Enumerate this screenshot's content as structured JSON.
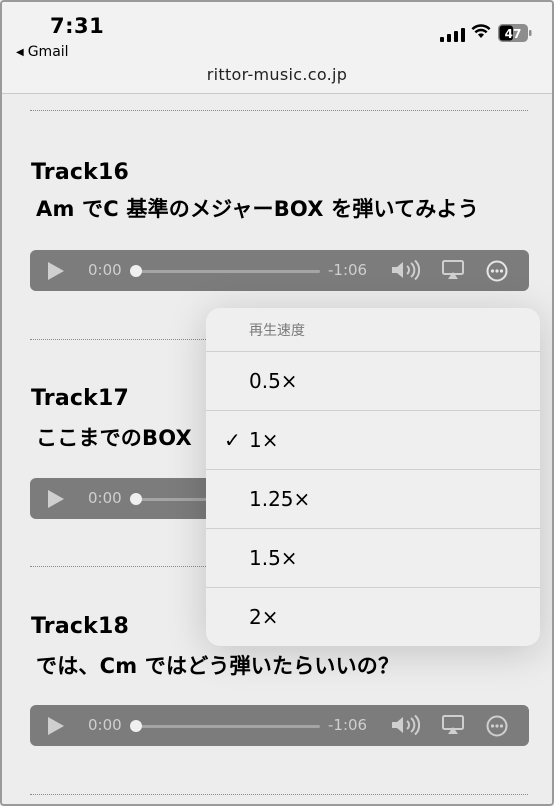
{
  "status_bar": {
    "time": "7:31",
    "back_app": "Gmail",
    "battery_level": "47"
  },
  "url_bar": {
    "domain": "rittor-music.co.jp"
  },
  "tracks": [
    {
      "title": "Track16",
      "subtitle": "Am でC 基準のメジャーBOX を弾いてみよう",
      "player": {
        "current": "0:00",
        "remaining": "-1:06"
      }
    },
    {
      "title": "Track17",
      "subtitle": "ここまでのBOX",
      "player": {
        "current": "0:00",
        "remaining": ""
      }
    },
    {
      "title": "Track18",
      "subtitle": "では、Cm ではどう弾いたらいいの？",
      "player": {
        "current": "0:00",
        "remaining": "-1:06"
      }
    }
  ],
  "speed_menu": {
    "header": "再生速度",
    "options": [
      {
        "label": "0.5×",
        "selected": false
      },
      {
        "label": "1×",
        "selected": true,
        "check": "✓"
      },
      {
        "label": "1.25×",
        "selected": false
      },
      {
        "label": "1.5×",
        "selected": false
      },
      {
        "label": "2×",
        "selected": false
      }
    ]
  }
}
